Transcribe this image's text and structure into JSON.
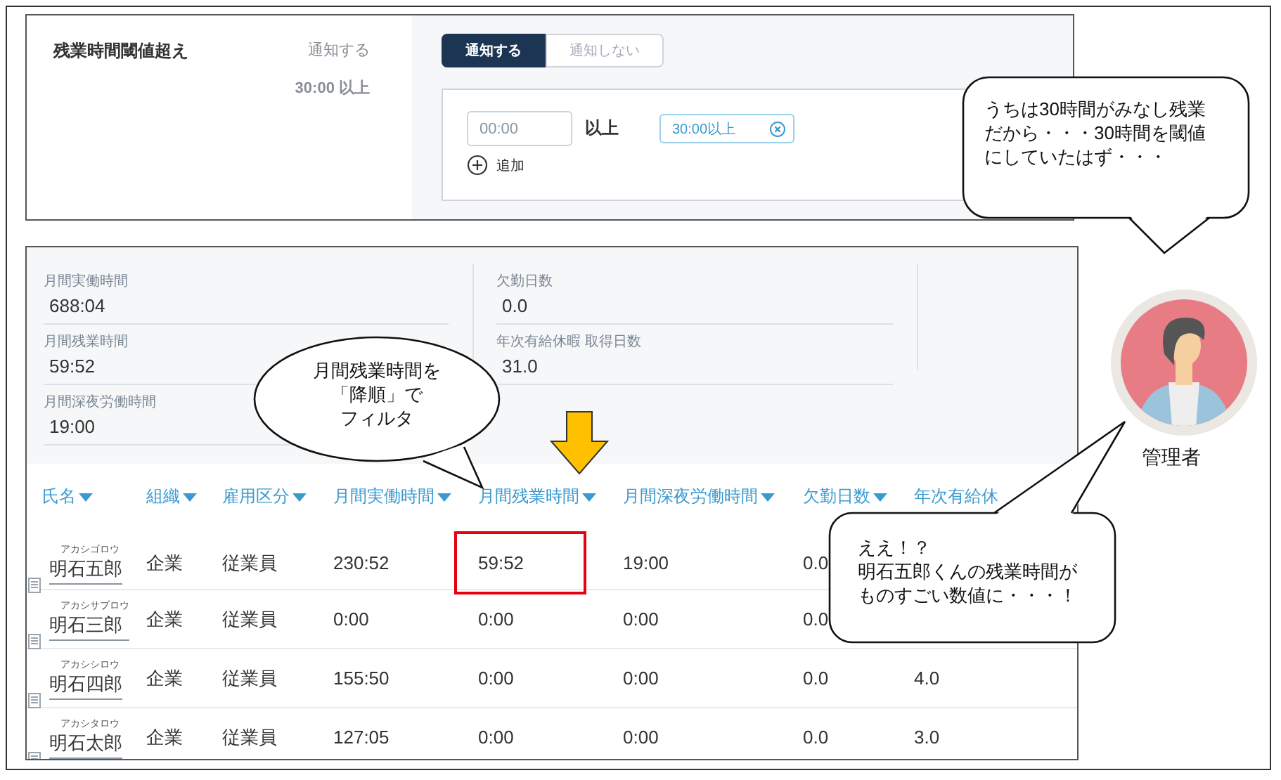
{
  "settings": {
    "title": "残業時間閾値超え",
    "status": "通知する",
    "threshold_summary": "30:00 以上",
    "toggle": [
      {
        "label": "通知する",
        "selected": true
      },
      {
        "label": "通知しない",
        "selected": false
      }
    ],
    "time_input": {
      "placeholder": "00:00"
    },
    "unit": "以上",
    "tags": [
      {
        "label": "30:00以上"
      }
    ],
    "add_label": "追加"
  },
  "summary": {
    "columns": [
      [
        {
          "label": "月間実働時間",
          "value": "688:04"
        },
        {
          "label": "月間残業時間",
          "value": "59:52"
        },
        {
          "label": "月間深夜労働時間",
          "value": "19:00"
        }
      ],
      [
        {
          "label": "欠勤日数",
          "value": "0.0"
        },
        {
          "label": "年次有給休暇 取得日数",
          "value": "31.0"
        }
      ]
    ]
  },
  "table": {
    "columns": [
      "氏名",
      "組織",
      "雇用区分",
      "月間実働時間",
      "月間残業時間",
      "月間深夜労働時間",
      "欠勤日数",
      "年次有給休"
    ],
    "rows": [
      {
        "cells": [
          {
            "furigana": "アカシゴロウ",
            "text": "明石五郎",
            "marked": false
          },
          {
            "text": "企業",
            "marked": false
          },
          {
            "text": "従業員",
            "marked": false
          },
          {
            "text": "230:52",
            "marked": false
          },
          {
            "text": "59:52",
            "marked": true
          },
          {
            "text": "19:00",
            "marked": false
          },
          {
            "text": "0.0",
            "marked": false
          }
        ]
      },
      {
        "cells": [
          {
            "furigana": "アカシサブロウ",
            "text": "明石三郎",
            "marked": false
          },
          {
            "text": "企業",
            "marked": false
          },
          {
            "text": "従業員",
            "marked": false
          },
          {
            "text": "0:00",
            "marked": false
          },
          {
            "text": "0:00",
            "marked": false
          },
          {
            "text": "0:00",
            "marked": false
          },
          {
            "text": "0.0",
            "marked": false
          }
        ]
      },
      {
        "cells": [
          {
            "furigana": "アカシシロウ",
            "text": "明石四郎",
            "marked": false
          },
          {
            "text": "企業",
            "marked": false
          },
          {
            "text": "従業員",
            "marked": false
          },
          {
            "text": "155:50",
            "marked": false
          },
          {
            "text": "0:00",
            "marked": false
          },
          {
            "text": "0:00",
            "marked": false
          },
          {
            "text": "0.0",
            "marked": false
          },
          {
            "text": "4.0",
            "marked": false
          }
        ]
      },
      {
        "cells": [
          {
            "furigana": "アカシタロウ",
            "text": "明石太郎",
            "marked": false
          },
          {
            "text": "企業",
            "marked": false
          },
          {
            "text": "従業員",
            "marked": false
          },
          {
            "text": "127:05",
            "marked": false
          },
          {
            "text": "0:00",
            "marked": false
          },
          {
            "text": "0:00",
            "marked": false
          },
          {
            "text": "0.0",
            "marked": false
          },
          {
            "text": "3.0",
            "marked": false
          }
        ]
      }
    ]
  },
  "bubbles": [
    {
      "kind": "rounded",
      "lines": [
        "うちは30時間がみなし残業",
        "だから・・・30時間を閾値",
        "にしていたはず・・・"
      ]
    },
    {
      "kind": "oval",
      "lines": [
        "月間残業時間を",
        "「降順」で",
        "フィルタ"
      ]
    },
    {
      "kind": "rounded",
      "lines": [
        "ええ！？",
        "明石五郎くんの残業時間が",
        "ものすごい数値に・・・！"
      ]
    }
  ],
  "avatar": {
    "label": "管理者"
  }
}
